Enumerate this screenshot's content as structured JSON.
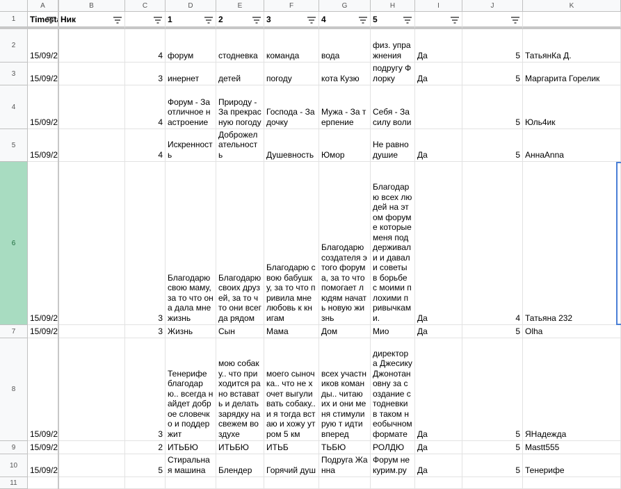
{
  "column_letters": [
    "A",
    "B",
    "C",
    "D",
    "E",
    "F",
    "G",
    "H",
    "I",
    "J",
    "K"
  ],
  "header_row": [
    "Timestamp",
    "Ник",
    "",
    "1",
    "2",
    "3",
    "4",
    "5",
    "",
    "",
    ""
  ],
  "row_numbers": [
    "1",
    "2",
    "3",
    "4",
    "5",
    "6",
    "7",
    "8",
    "9",
    "10",
    "11"
  ],
  "rows": [
    [
      "15/09/2",
      "",
      "4",
      "форум",
      "стодневка",
      "команда",
      "вода",
      "физ. упражнения",
      "Да",
      "5",
      "ТатьянКа Д."
    ],
    [
      "15/09/2",
      "",
      "3",
      "инернет",
      "детей",
      "погоду",
      "кота Кузю",
      "подругу Флорку",
      "Да",
      "5",
      "Маргарита Горелик"
    ],
    [
      "15/09/2",
      "",
      "4",
      "Форум - За отличное настроение",
      " Природу - За прекрасную погоду",
      "Господа - За дочку",
      "Мужа - За терпение",
      "Себя - За силу воли",
      "",
      "5",
      "Юль4ик"
    ],
    [
      "15/09/2",
      "",
      "4",
      "Искренность",
      "Доброжелательность",
      "Душевность",
      "Юмор",
      "Не равнодушие",
      "Да",
      "5",
      "АннаAnna"
    ],
    [
      "15/09/2",
      "",
      "3",
      "Благодарю свою маму, за то что она дала мне жизнь",
      "Благодарю своих друзей, за то что они всегда рядом",
      "Благодарю свою бабушку, за то что привила мне любовь к книгам",
      "Благодарю создателя этого форума, за то что помогает людям начать новую жизнь",
      "Благодарю всех людей на этом форуме которые меня поддерживали и давали советы в борьбе с моими плохими привычками.",
      "Да",
      "4",
      "Татьяна 232"
    ],
    [
      "15/09/2",
      "",
      "3",
      "Жизнь",
      "Сын",
      "Мама",
      "Дом",
      "Мио",
      "Да",
      "5",
      "Olha"
    ],
    [
      "15/09/2",
      "",
      "3",
      "Тенерифе благодарю.. всегда найдет доброе словечко и поддержит",
      "мою собаку.. что приходится рано вставать и делать зарядку на свежем воздухе",
      "моего сыночка.. что не хочет выгуливать собаку.. и я тогда встаю и хожу утром 5 км",
      "всех участников команды.. читаю их и они меня стимулирую т идти вперед",
      "директора Джесику Джонотановну за создание стодневки в таком необычном формате",
      "Да",
      "5",
      "ЯНадежда"
    ],
    [
      "15/09/2",
      "",
      "2",
      "ИТЬБЮ",
      "ИТЬБЮ",
      "ИТЬБ",
      "ТЬБЮ",
      "РОЛДЮ",
      "Да",
      "5",
      "Mastt555"
    ],
    [
      "15/09/2",
      "",
      "5",
      "Стиральная машина",
      "Блендер",
      "Горячий душ",
      "Подруга Жанна",
      "Форум не курим.ру",
      "Да",
      "5",
      "Тенерифе"
    ],
    [
      "",
      "",
      "",
      "",
      "",
      "",
      "",
      "",
      "",
      "",
      ""
    ]
  ],
  "selected_row": "6",
  "colors": {
    "header_bg": "#f8f9fa",
    "selected_row_bg": "#a8dcc1",
    "selection_border": "#4a7fd6"
  }
}
